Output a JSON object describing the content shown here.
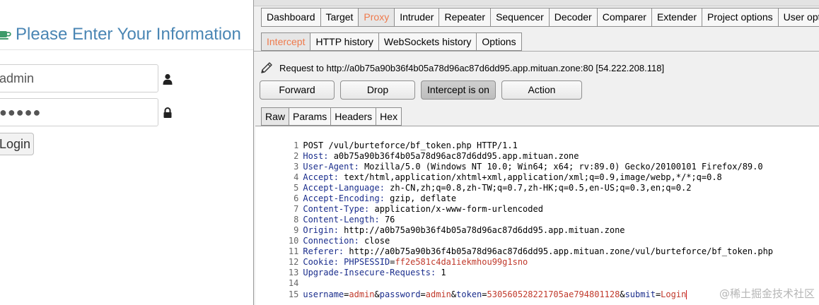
{
  "login": {
    "title": "Please Enter Your Information",
    "username_value": "admin",
    "password_value": "●●●●●",
    "login_label": "Login"
  },
  "burp": {
    "main_tabs": [
      "Dashboard",
      "Target",
      "Proxy",
      "Intruder",
      "Repeater",
      "Sequencer",
      "Decoder",
      "Comparer",
      "Extender",
      "Project options",
      "User options"
    ],
    "sub_tabs": [
      "Intercept",
      "HTTP history",
      "WebSockets history",
      "Options"
    ],
    "request_info": "Request to http://a0b75a90b36f4b05a78d96ac87d6dd95.app.mituan.zone:80  [54.222.208.118]",
    "buttons": {
      "forward": "Forward",
      "drop": "Drop",
      "intercept": "Intercept is on",
      "action": "Action"
    },
    "view_tabs": [
      "Raw",
      "Params",
      "Headers",
      "Hex"
    ],
    "request_lines": [
      {
        "n": "1",
        "text": "POST /vul/burteforce/bf_token.php HTTP/1.1"
      },
      {
        "n": "2",
        "name": "Host:",
        "value": " a0b75a90b36f4b05a78d96ac87d6dd95.app.mituan.zone"
      },
      {
        "n": "3",
        "name": "User-Agent:",
        "value": " Mozilla/5.0 (Windows NT 10.0; Win64; x64; rv:89.0) Gecko/20100101 Firefox/89.0"
      },
      {
        "n": "4",
        "name": "Accept:",
        "value": " text/html,application/xhtml+xml,application/xml;q=0.9,image/webp,*/*;q=0.8"
      },
      {
        "n": "5",
        "name": "Accept-Language:",
        "value": " zh-CN,zh;q=0.8,zh-TW;q=0.7,zh-HK;q=0.5,en-US;q=0.3,en;q=0.2"
      },
      {
        "n": "6",
        "name": "Accept-Encoding:",
        "value": " gzip, deflate"
      },
      {
        "n": "7",
        "name": "Content-Type:",
        "value": " application/x-www-form-urlencoded"
      },
      {
        "n": "8",
        "name": "Content-Length:",
        "value": " 76"
      },
      {
        "n": "9",
        "name": "Origin:",
        "value": " http://a0b75a90b36f4b05a78d96ac87d6dd95.app.mituan.zone"
      },
      {
        "n": "10",
        "name": "Connection:",
        "value": " close"
      },
      {
        "n": "11",
        "name": "Referer:",
        "value": " http://a0b75a90b36f4b05a78d96ac87d6dd95.app.mituan.zone/vul/burteforce/bf_token.php"
      },
      {
        "n": "12",
        "name": "Cookie:",
        "value": " ",
        "cookie_name": "PHPSESSID",
        "cookie_eq": "=",
        "cookie_value": "ff2e581c4da1iekmhou99g1sno"
      },
      {
        "n": "13",
        "name": "Upgrade-Insecure-Requests:",
        "value": " 1"
      },
      {
        "n": "14",
        "text": ""
      }
    ],
    "body_line": {
      "n": "15",
      "p1": "username",
      "v1": "admin",
      "p2": "password",
      "v2": "admin",
      "p3": "token",
      "v3": "530560528221705ae794801128",
      "p4": "submit",
      "v4": "Login"
    }
  },
  "watermark": "@稀土掘金技术社区"
}
